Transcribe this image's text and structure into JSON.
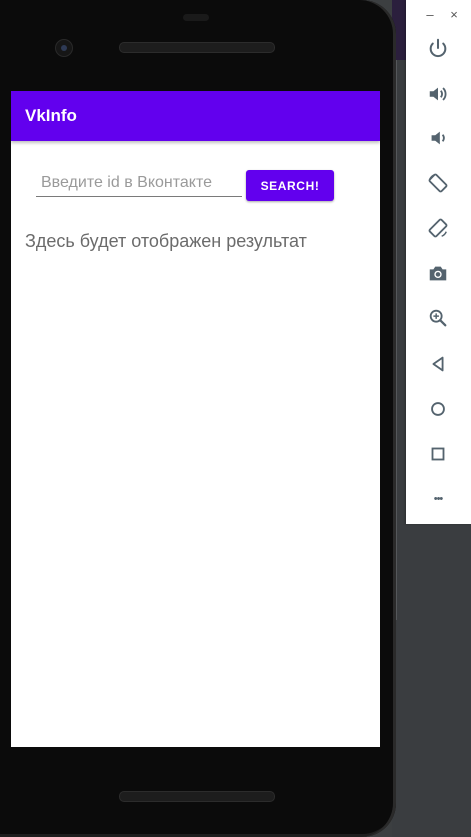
{
  "app": {
    "title": "VkInfo"
  },
  "search": {
    "placeholder": "Введите id в Вконтакте",
    "value": "",
    "button_label": "SEARCH!"
  },
  "result": {
    "text": "Здесь будет отображен результат"
  },
  "toolbar": {
    "minimize_glyph": "–",
    "close_glyph": "×",
    "more_glyph": "•••",
    "icons": [
      "power-icon",
      "volume-up-icon",
      "volume-down-icon",
      "rotate-left-icon",
      "rotate-right-icon",
      "camera-icon",
      "zoom-icon",
      "back-icon",
      "home-icon",
      "overview-icon",
      "more-icon"
    ]
  },
  "colors": {
    "primary": "#6200ee",
    "toolbar_icon": "#54636e"
  }
}
